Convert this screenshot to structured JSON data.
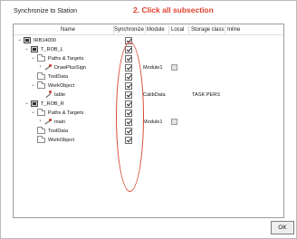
{
  "dialog": {
    "title": "Synchronize to Station",
    "annotation": "2. Click all subsection",
    "ok_label": "OK"
  },
  "columns": {
    "name": "Name",
    "synchronize": "Synchronize",
    "module": "Module",
    "local": "Local",
    "storage_class": "Storage class",
    "inline": "Inline"
  },
  "rows": [
    {
      "label": "IRB14000",
      "icon": "robot-icon",
      "expander": "collapse",
      "checked": true
    },
    {
      "label": "T_ROB_L",
      "icon": "robot-task-icon",
      "expander": "collapse",
      "checked": true
    },
    {
      "label": "Paths & Targets",
      "icon": "folder-icon",
      "expander": "collapse",
      "checked": true
    },
    {
      "label": "DrawPlusSign",
      "icon": "path-icon",
      "expander": "expand",
      "checked": true,
      "module": "Module1",
      "local": false
    },
    {
      "label": "ToolData",
      "icon": "folder-icon",
      "checked": true
    },
    {
      "label": "WorkObject",
      "icon": "folder-icon",
      "expander": "collapse",
      "checked": true
    },
    {
      "label": "table",
      "icon": "workobject-icon",
      "checked": true,
      "module": "CalibData",
      "storage": "TASK PERS"
    },
    {
      "label": "T_ROB_R",
      "icon": "robot-task-icon",
      "expander": "collapse",
      "checked": true
    },
    {
      "label": "Paths & Targets",
      "icon": "folder-icon",
      "expander": "collapse",
      "checked": true
    },
    {
      "label": "main",
      "icon": "path-icon",
      "expander": "expand",
      "checked": true,
      "module": "Module1",
      "local": false
    },
    {
      "label": "ToolData",
      "icon": "folder-icon",
      "checked": true
    },
    {
      "label": "WorkObject",
      "icon": "folder-icon",
      "checked": true
    }
  ]
}
